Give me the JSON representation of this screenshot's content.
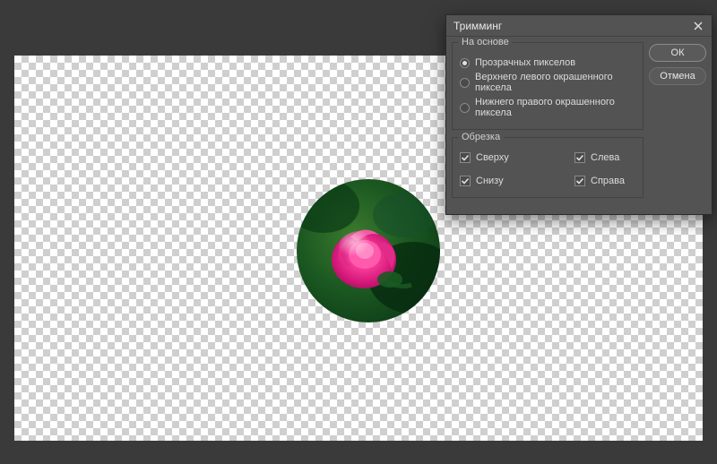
{
  "dialog": {
    "title": "Тримминг",
    "ok_label": "ОК",
    "cancel_label": "Отмена",
    "group_based_on": {
      "legend": "На основе",
      "options": {
        "transparent": "Прозрачных пикселов",
        "top_left": "Верхнего левого окрашенного пиксела",
        "bottom_right": "Нижнего правого окрашенного пиксела"
      },
      "selected": "transparent"
    },
    "group_crop": {
      "legend": "Обрезка",
      "options": {
        "top": "Сверху",
        "bottom": "Снизу",
        "left": "Слева",
        "right": "Справа"
      },
      "checked": {
        "top": true,
        "bottom": true,
        "left": true,
        "right": true
      }
    }
  }
}
